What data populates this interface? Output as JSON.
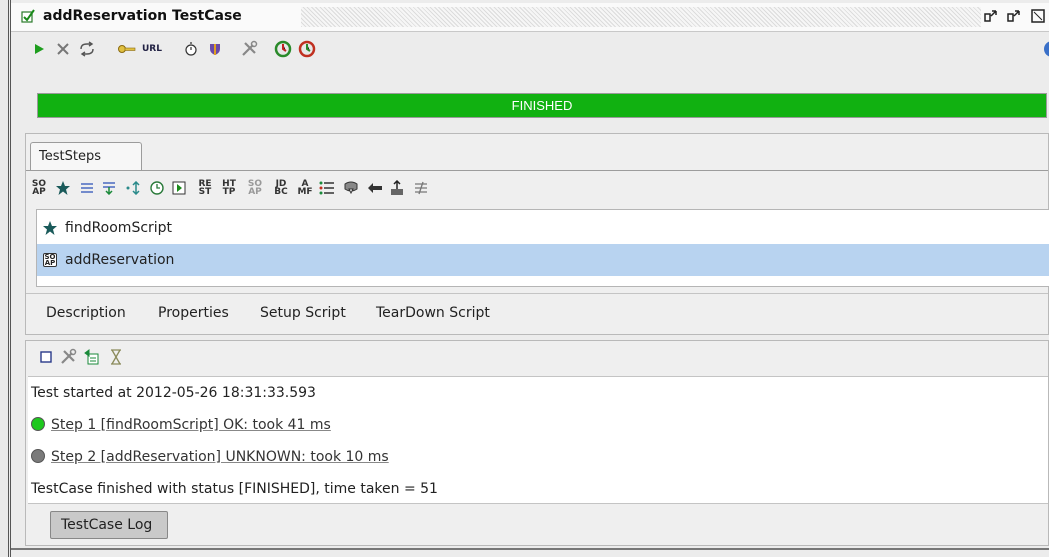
{
  "window": {
    "title": "addReservation TestCase",
    "controls": [
      "restore-icon",
      "restore-icon",
      "maximize-icon"
    ]
  },
  "toolbar": {
    "items": [
      "run-icon",
      "cancel-icon",
      "loop-icon",
      "key-icon",
      "url-icon",
      "timer-icon",
      "shield-icon",
      "tools-icon",
      "loadtest-icon",
      "security-icon"
    ],
    "url_label": "URL"
  },
  "progress": {
    "status": "FINISHED",
    "fraction": 1.0,
    "color": "#11b111"
  },
  "steps_panel": {
    "tab_label": "TestSteps",
    "toolbar_labels": {
      "soap": "SO\nAP",
      "rest": "RE\nST",
      "http": "HT\nTP",
      "soap_mock": "SO\nAP",
      "jdbc": "JD\nBC",
      "amf": "A\nMF"
    },
    "steps": [
      {
        "icon": "groovy-star-icon",
        "label": "findRoomScript",
        "selected": false
      },
      {
        "icon": "soap-request-icon",
        "label": "addReservation",
        "selected": true
      }
    ],
    "soap_icon_text": "SO\nAP",
    "tabs": [
      "Description",
      "Properties",
      "Setup Script",
      "TearDown Script"
    ]
  },
  "log_panel": {
    "toolbar": [
      "clear-icon",
      "tools-icon",
      "export-icon",
      "hourglass-icon"
    ],
    "lines": {
      "started": "Test started at 2012-05-26 18:31:33.593",
      "step1": "Step 1 [findRoomScript] OK: took 41 ms",
      "step2": "Step 2 [addReservation] UNKNOWN: took 10 ms",
      "finished": "TestCase finished with status [FINISHED], time taken = 51"
    },
    "step1_status_color": "#1ec81e",
    "step2_status_color": "#7a7a7a",
    "tab_label": "TestCase Log"
  }
}
